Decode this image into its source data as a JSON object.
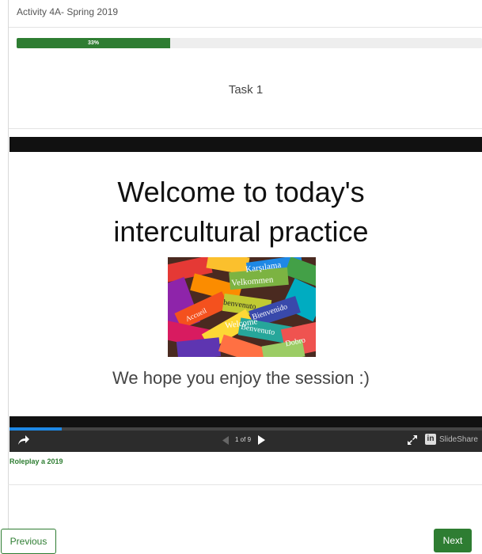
{
  "header": {
    "activity_title": "Activity 4A- Spring 2019"
  },
  "progress": {
    "value": 0.33,
    "label": "33%",
    "color": "#2e7d32"
  },
  "task": {
    "title": "Task 1"
  },
  "slide": {
    "headline_line1": "Welcome to today's",
    "headline_line2": "intercultural practice",
    "image_words": [
      "Karşılama",
      "Velkommen",
      "benvenuto",
      "Welcome",
      "Bienvenido",
      "Accueil",
      "Benvenuto",
      "Dobro"
    ],
    "subtitle": "We hope you enjoy the session :)"
  },
  "player": {
    "page_counter": "1 of 9",
    "progress_value": 0.11,
    "brand_label": "SlideShare",
    "linkedin_glyph": "in",
    "accent_color": "#1e88e5"
  },
  "source_link": "Roleplay a 2019",
  "navigation": {
    "previous_label": "Previous",
    "next_label": "Next"
  }
}
